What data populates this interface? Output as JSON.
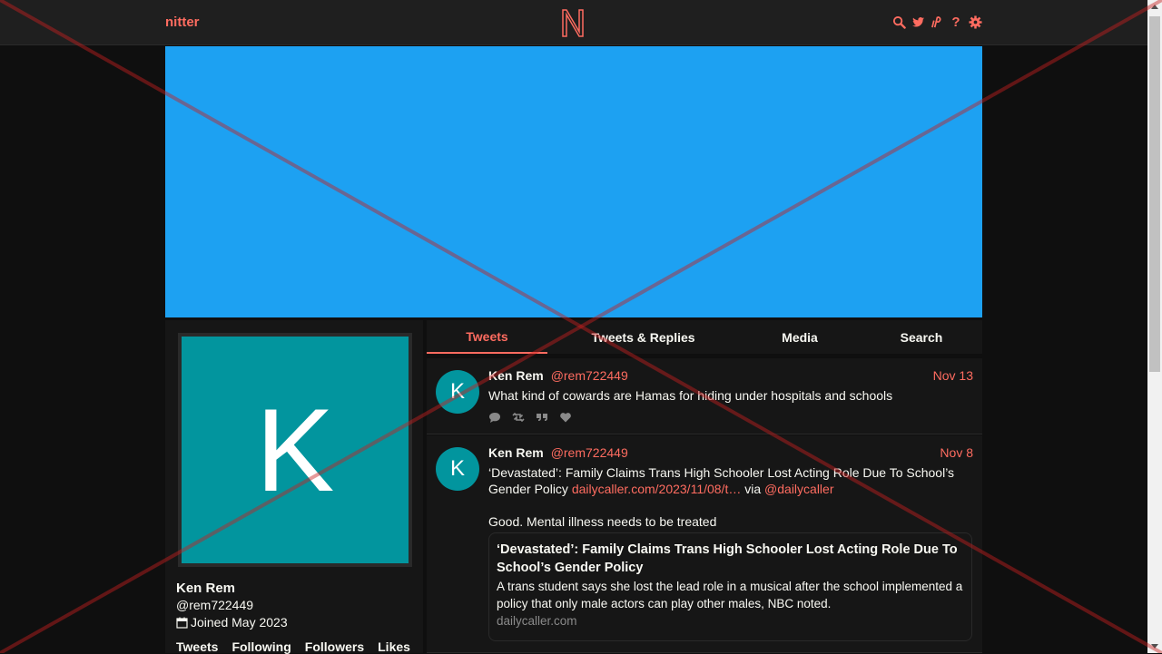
{
  "navbar": {
    "brand": "nitter",
    "icons": [
      "search-icon",
      "twitter-icon",
      "rss-icon",
      "help-icon",
      "gear-icon"
    ],
    "help_glyph": "?"
  },
  "colors": {
    "accent": "#ff6c60",
    "banner": "#1da1f2",
    "avatar": "#02959e",
    "background": "#0f0f0f",
    "panel": "#161616"
  },
  "profile": {
    "avatar_letter": "K",
    "name": "Ken Rem",
    "handle": "@rem722449",
    "joined": "Joined May 2023",
    "stats": [
      "Tweets",
      "Following",
      "Followers",
      "Likes"
    ]
  },
  "tabs": [
    {
      "label": "Tweets",
      "active": true
    },
    {
      "label": "Tweets & Replies",
      "active": false
    },
    {
      "label": "Media",
      "active": false
    },
    {
      "label": "Search",
      "active": false
    }
  ],
  "tweets": [
    {
      "avatar_letter": "K",
      "name": "Ken Rem",
      "username": "@rem722449",
      "date": "Nov 13",
      "text": "What kind of cowards are Hamas for hiding under hospitals and schools"
    },
    {
      "avatar_letter": "K",
      "name": "Ken Rem",
      "username": "@rem722449",
      "date": "Nov 8",
      "text_main": "‘Devastated’: Family Claims Trans High Schooler Lost Acting Role Due To School’s Gender Policy ",
      "link": "dailycaller.com/2023/11/08/t…",
      "via": " via ",
      "mention": "@dailycaller",
      "text_second": "Good. Mental illness needs to be treated",
      "card": {
        "title": "‘Devastated’: Family Claims Trans High Schooler Lost Acting Role Due To School’s Gender Policy",
        "description": "A trans student says she lost the lead role in a musical after the school implemented a policy that only male actors can play other males, NBC noted.",
        "domain": "dailycaller.com"
      }
    }
  ]
}
